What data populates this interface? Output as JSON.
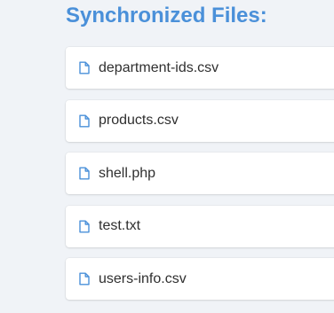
{
  "header": {
    "title": "Synchronized Files:"
  },
  "files": [
    {
      "name": "department-ids.csv",
      "icon": "file-icon"
    },
    {
      "name": "products.csv",
      "icon": "file-icon"
    },
    {
      "name": "shell.php",
      "icon": "file-icon"
    },
    {
      "name": "test.txt",
      "icon": "file-icon"
    },
    {
      "name": "users-info.csv",
      "icon": "file-icon"
    }
  ],
  "colors": {
    "accent": "#4a90d9",
    "background": "#f0f3f7",
    "card": "#ffffff",
    "text": "#2f2f2f"
  }
}
